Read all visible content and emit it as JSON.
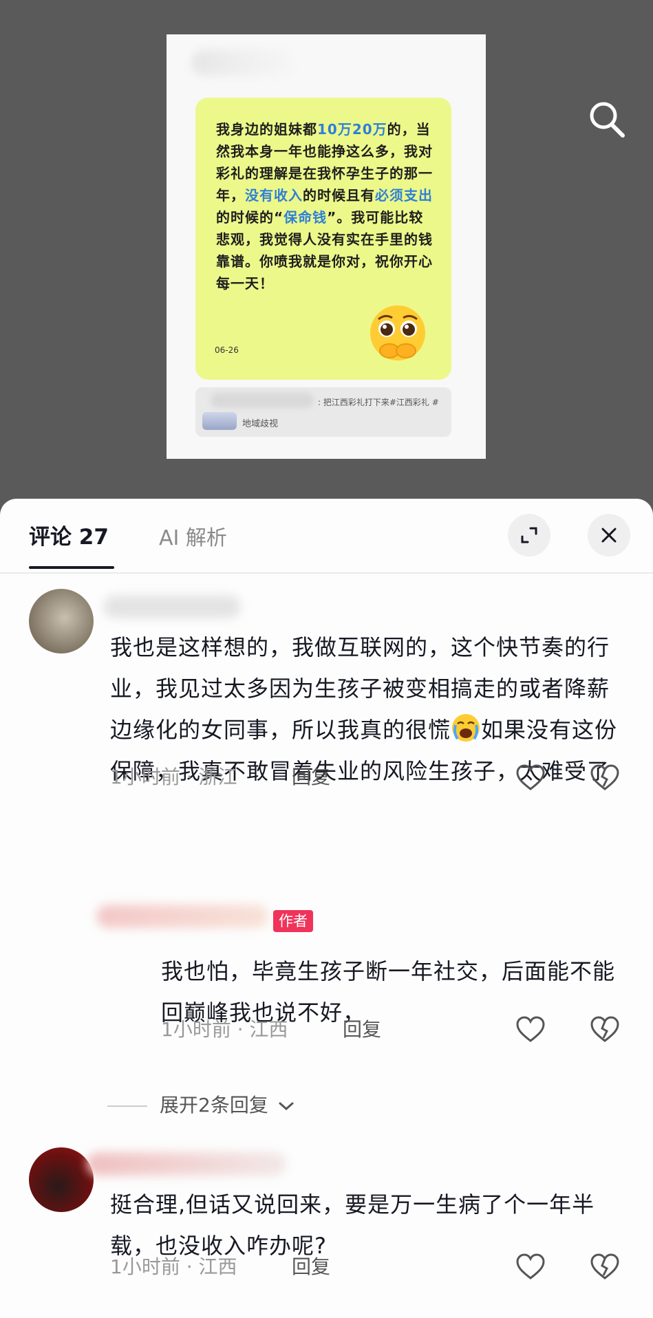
{
  "post_image": {
    "message": {
      "segments": [
        {
          "text": "我身边的姐妹都",
          "highlight": false
        },
        {
          "text": "10万20万",
          "highlight": true
        },
        {
          "text": "的，当然我本身一年也能挣这么多，我对彩礼的理解是在我怀孕生子的那一年，",
          "highlight": false
        },
        {
          "text": "没有收入",
          "highlight": true
        },
        {
          "text": "的时候且有",
          "highlight": false
        },
        {
          "text": "必须支出",
          "highlight": true
        },
        {
          "text": "的时候的“",
          "highlight": false
        },
        {
          "text": "保命钱",
          "highlight": true
        },
        {
          "text": "”。我可能比较悲观，我觉得人没有实在手里的钱靠谱。你喷我就是你对，祝你开心每一天！",
          "highlight": false
        }
      ],
      "date": "06-26",
      "bubble_color": "#ecf88a",
      "highlight_color": "#2f7fd8"
    },
    "reference": {
      "line1": ": 把江西彩礼打下来#江西彩礼 #",
      "line2": "地域歧视"
    }
  },
  "search_icon": "search-icon",
  "sheet": {
    "tabs": {
      "comments": "评论 27",
      "ai": "AI 解析"
    },
    "comments": [
      {
        "text_before_emoji": "我也是这样想的，我做互联网的，这个快节奏的行业，我见过太多因为生孩子被变相搞走的或者降薪边缘化的女同事，所以我真的很慌",
        "text_after_emoji": "如果没有这份保障，我真不敢冒着失业的风险生孩子，太难受了",
        "emoji": "loudly-crying-emoji",
        "time": "1小时前 · 浙江",
        "reply": "回复"
      },
      {
        "badge": "作者",
        "text": "我也怕，毕竟生孩子断一年社交，后面能不能回巅峰我也说不好，",
        "time": "1小时前 · 江西",
        "reply": "回复"
      },
      {
        "text": "挺合理,但话又说回来，要是万一生病了个一年半载，也没收入咋办呢?",
        "time": "1小时前 · 江西",
        "reply": "回复"
      }
    ],
    "expand_replies": "展开2条回复",
    "author_badge_color": "#f0335a"
  }
}
